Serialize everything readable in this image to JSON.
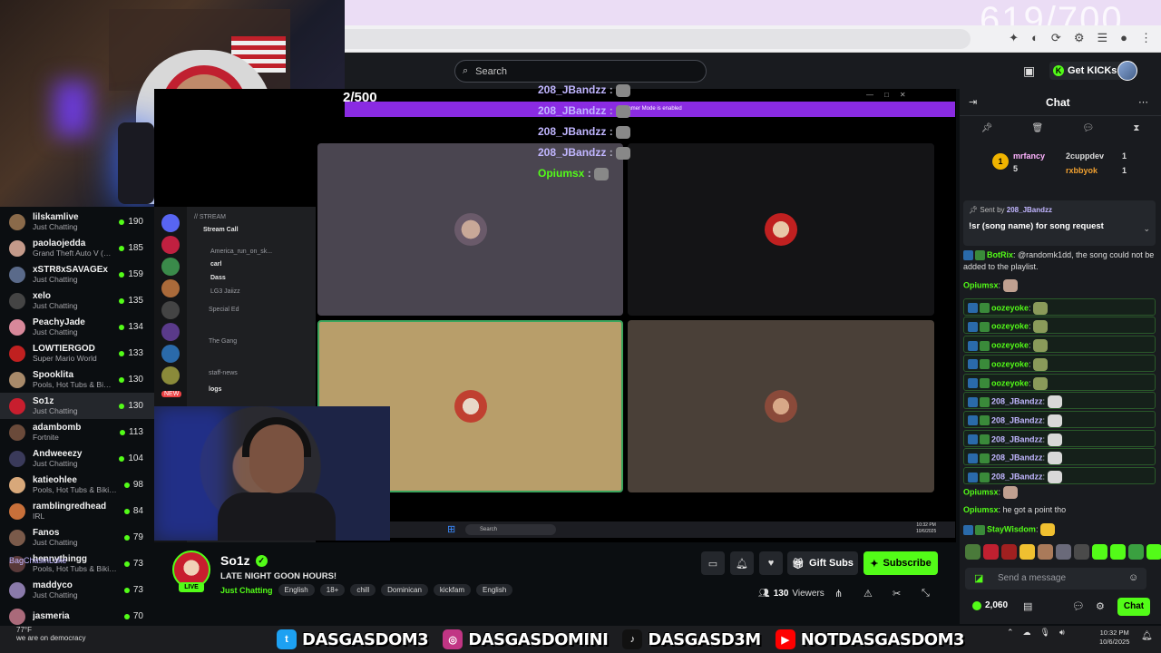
{
  "header": {
    "overlay_counter_top": "619/700",
    "search_placeholder": "Search",
    "get_kicks_label": "Get KICKs"
  },
  "sidebar": {
    "items": [
      {
        "name": "lilskamlive",
        "category": "Just Chatting",
        "viewers": "190",
        "color": "#8a6a4a"
      },
      {
        "name": "paolaojedda",
        "category": "Grand Theft Auto V (G...",
        "viewers": "185",
        "color": "#c49a8a"
      },
      {
        "name": "xSTR8xSAVAGEx",
        "category": "Just Chatting",
        "viewers": "159",
        "color": "#5a6a8a"
      },
      {
        "name": "xelo",
        "category": "Just Chatting",
        "viewers": "135",
        "color": "#444"
      },
      {
        "name": "PeachyJade",
        "category": "Just Chatting",
        "viewers": "134",
        "color": "#d8889a"
      },
      {
        "name": "LOWTIERGOD",
        "category": "Super Mario World",
        "viewers": "133",
        "color": "#c02020"
      },
      {
        "name": "Spooklita",
        "category": "Pools, Hot Tubs & Bikinis",
        "viewers": "130",
        "color": "#a88a6a"
      },
      {
        "name": "So1z",
        "category": "Just Chatting",
        "viewers": "130",
        "color": "#c81e2e"
      },
      {
        "name": "adambomb",
        "category": "Fortnite",
        "viewers": "113",
        "color": "#6a4a3a"
      },
      {
        "name": "Andweeezy",
        "category": "Just Chatting",
        "viewers": "104",
        "color": "#3a3a5a"
      },
      {
        "name": "katieohlee",
        "category": "Pools, Hot Tubs & Bikinis",
        "viewers": "98",
        "color": "#d8a87a"
      },
      {
        "name": "ramblingredhead",
        "category": "IRL",
        "viewers": "84",
        "color": "#c8703a"
      },
      {
        "name": "Fanos",
        "category": "Just Chatting",
        "viewers": "79",
        "color": "#7a5a4a"
      },
      {
        "name": "hennythingg",
        "category": "Pools, Hot Tubs & Bikinis",
        "viewers": "73",
        "color": "#5a3a3a"
      },
      {
        "name": "maddyco",
        "category": "Just Chatting",
        "viewers": "73",
        "color": "#8a7aaa"
      },
      {
        "name": "jasmeria",
        "category": "",
        "viewers": "70",
        "color": "#aa6a7a"
      }
    ]
  },
  "stream_overlay": {
    "counter": "2/500",
    "banner": "Streamer Mode is enabled",
    "chat_lines": [
      {
        "user": "208_JBandzz",
        "suffix": ":"
      },
      {
        "user": "208_JBandzz",
        "suffix": ":"
      },
      {
        "user": "208_JBandzz",
        "suffix": ":"
      },
      {
        "user": "208_JBandzz",
        "suffix": ":"
      },
      {
        "user": "Opiumsx",
        "suffix": ":"
      }
    ],
    "discord": {
      "header": "// STREAM",
      "stream_call": "Stream Call",
      "members": [
        "America_run_on_sk...",
        "carl",
        "Dass",
        "LG3 Jaiizz"
      ],
      "channels": [
        "Special Ed",
        "The Gang",
        "staff-news",
        "logs"
      ],
      "new_label": "NEW"
    },
    "taskbar_search": "Search",
    "taskbar_time": "10:32 PM",
    "taskbar_date": "10/6/2025"
  },
  "channel": {
    "name": "So1z",
    "live_label": "LIVE",
    "title": "LATE NIGHT GOON HOURS!",
    "category": "Just Chatting",
    "tags": [
      "English",
      "18+",
      "chill",
      "Dominican",
      "kickfam",
      "English"
    ],
    "viewers_count": "130",
    "viewers_label": "Viewers",
    "gift_subs_label": "Gift Subs",
    "subscribe_label": "Subscribe"
  },
  "chat": {
    "title": "Chat",
    "leaderboard": [
      {
        "rank": "1",
        "name": "mrfancy",
        "count": "5"
      },
      {
        "name": "2cuppdev",
        "count": "1"
      },
      {
        "name": "rxbbyok",
        "count": "1"
      }
    ],
    "pinned": {
      "sent_by_label": "Sent by",
      "sent_by_user": "208_JBandzz",
      "message": "!sr (song name) for song request"
    },
    "messages": [
      {
        "user": "BotRix",
        "text": "@randomk1dd, the song could not be added to the playlist.",
        "color": "#53fc18"
      },
      {
        "user": "Opiumsx",
        "text": "",
        "color": "#53fc18"
      },
      {
        "user": "oozeyoke",
        "text": "",
        "color": "#53fc18"
      },
      {
        "user": "oozeyoke",
        "text": "",
        "color": "#53fc18"
      },
      {
        "user": "oozeyoke",
        "text": "",
        "color": "#53fc18"
      },
      {
        "user": "oozeyoke",
        "text": "",
        "color": "#53fc18"
      },
      {
        "user": "oozeyoke",
        "text": "",
        "color": "#53fc18"
      },
      {
        "user": "208_JBandzz",
        "text": "",
        "color": "#c1b6ff"
      },
      {
        "user": "208_JBandzz",
        "text": "",
        "color": "#c1b6ff"
      },
      {
        "user": "208_JBandzz",
        "text": "",
        "color": "#c1b6ff"
      },
      {
        "user": "208_JBandzz",
        "text": "",
        "color": "#c1b6ff"
      },
      {
        "user": "208_JBandzz",
        "text": "",
        "color": "#c1b6ff"
      },
      {
        "user": "Opiumsx",
        "text": "",
        "color": "#53fc18"
      },
      {
        "user": "Opiumsx",
        "text": "he got a point tho",
        "color": "#53fc18"
      },
      {
        "user": "StayWisdom",
        "text": "",
        "color": "#53fc18"
      }
    ],
    "input_placeholder": "Send a message",
    "points": "2,060",
    "send_label": "Chat"
  },
  "socials": [
    {
      "platform": "twitter",
      "handle": "DASGASDOM3",
      "color": "#1da1f2",
      "glyph": "t"
    },
    {
      "platform": "instagram",
      "handle": "DASGASDOMINI",
      "color": "#c13584",
      "glyph": "◎"
    },
    {
      "platform": "tiktok",
      "handle": "DASGASD3M",
      "color": "#111111",
      "glyph": "♪"
    },
    {
      "platform": "youtube",
      "handle": "NOTDASGASDOM3",
      "color": "#ff0000",
      "glyph": "▶"
    }
  ],
  "system": {
    "weather_temp": "77°F",
    "time": "10:32 PM",
    "date": "10/6/2025",
    "overlay_fragment_1": "BagChasinLuke",
    "overlay_fragment_2": "we are on democracy"
  },
  "colors": {
    "kick_green": "#53fc18",
    "background": "#0b0e11",
    "panel": "#191b1f",
    "username_purple": "#c1b6ff"
  }
}
